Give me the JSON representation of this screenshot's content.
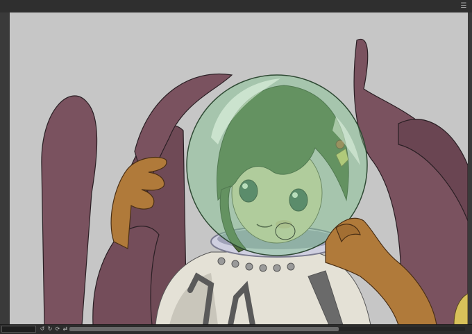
{
  "window": {
    "menu_icon": "menu-icon"
  },
  "canvas": {
    "background_color": "#c6c6c6",
    "tentacle_color": "#7a525f",
    "glove_color": "#b07a3a",
    "helmet_tint": "#7fc48e",
    "hair_color": "#4f6b3c",
    "suit_color": "#e4e1d6"
  },
  "status_bar": {
    "zoom_value": "",
    "buttons": [
      "rotate-left-icon",
      "rotate-reset-icon",
      "rotate-right-icon",
      "flip-icon"
    ],
    "horizontal_scroll_position": 0.68
  }
}
